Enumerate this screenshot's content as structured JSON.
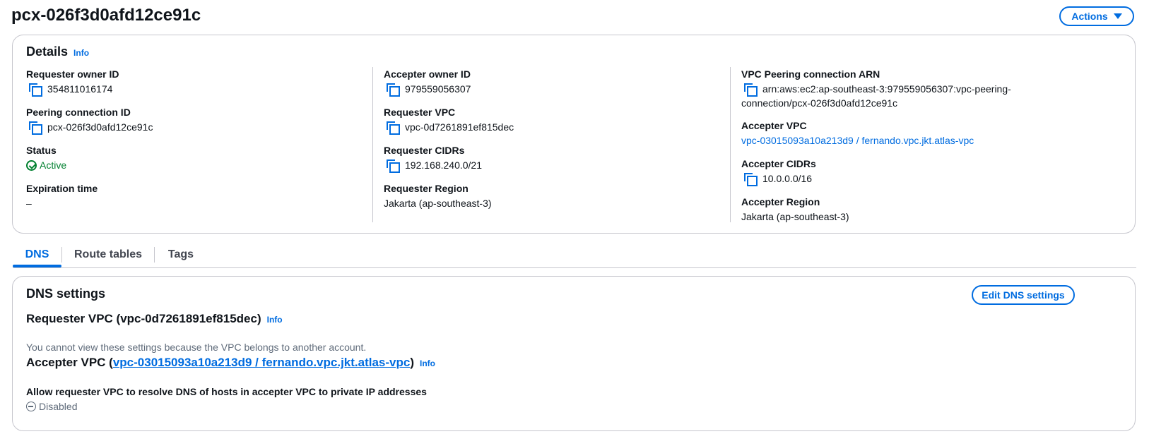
{
  "page": {
    "title": "pcx-026f3d0afd12ce91c",
    "actions_label": "Actions"
  },
  "details": {
    "title": "Details",
    "info_label": "Info",
    "col1": {
      "requester_owner_id": {
        "label": "Requester owner ID",
        "value": "354811016174"
      },
      "peering_connection_id": {
        "label": "Peering connection ID",
        "value": "pcx-026f3d0afd12ce91c"
      },
      "status": {
        "label": "Status",
        "value": "Active"
      },
      "expiration_time": {
        "label": "Expiration time",
        "value": "–"
      }
    },
    "col2": {
      "accepter_owner_id": {
        "label": "Accepter owner ID",
        "value": "979559056307"
      },
      "requester_vpc": {
        "label": "Requester VPC",
        "value": "vpc-0d7261891ef815dec"
      },
      "requester_cidrs": {
        "label": "Requester CIDRs",
        "value": "192.168.240.0/21"
      },
      "requester_region": {
        "label": "Requester Region",
        "value": "Jakarta (ap-southeast-3)"
      }
    },
    "col3": {
      "arn": {
        "label": "VPC Peering connection ARN",
        "value_line1": "arn:aws:ec2:ap-southeast-3:979559056307:vpc-peering-",
        "value_line2": "connection/pcx-026f3d0afd12ce91c"
      },
      "accepter_vpc": {
        "label": "Accepter VPC",
        "value": "vpc-03015093a10a213d9 / fernando.vpc.jkt.atlas-vpc"
      },
      "accepter_cidrs": {
        "label": "Accepter CIDRs",
        "value": "10.0.0.0/16"
      },
      "accepter_region": {
        "label": "Accepter Region",
        "value": "Jakarta (ap-southeast-3)"
      }
    }
  },
  "tabs": [
    {
      "label": "DNS",
      "active": true
    },
    {
      "label": "Route tables",
      "active": false
    },
    {
      "label": "Tags",
      "active": false
    }
  ],
  "dns": {
    "title": "DNS settings",
    "edit_label": "Edit DNS settings",
    "requester_title": "Requester VPC (vpc-0d7261891ef815dec)",
    "info_label": "Info",
    "requester_note": "You cannot view these settings because the VPC belongs to another account.",
    "accepter_prefix": "Accepter VPC (",
    "accepter_link": "vpc-03015093a10a213d9 / fernando.vpc.jkt.atlas-vpc",
    "accepter_suffix": ")",
    "allow_label": "Allow requester VPC to resolve DNS of hosts in accepter VPC to private IP addresses",
    "allow_value": "Disabled"
  },
  "colors": {
    "accent": "#006ce0",
    "success": "#00802f",
    "muted": "#5f6b7a",
    "border": "#c6c6cd"
  },
  "icons": [
    "copy-icon",
    "check-circle-icon",
    "disabled-circle-icon",
    "caret-down-icon"
  ]
}
